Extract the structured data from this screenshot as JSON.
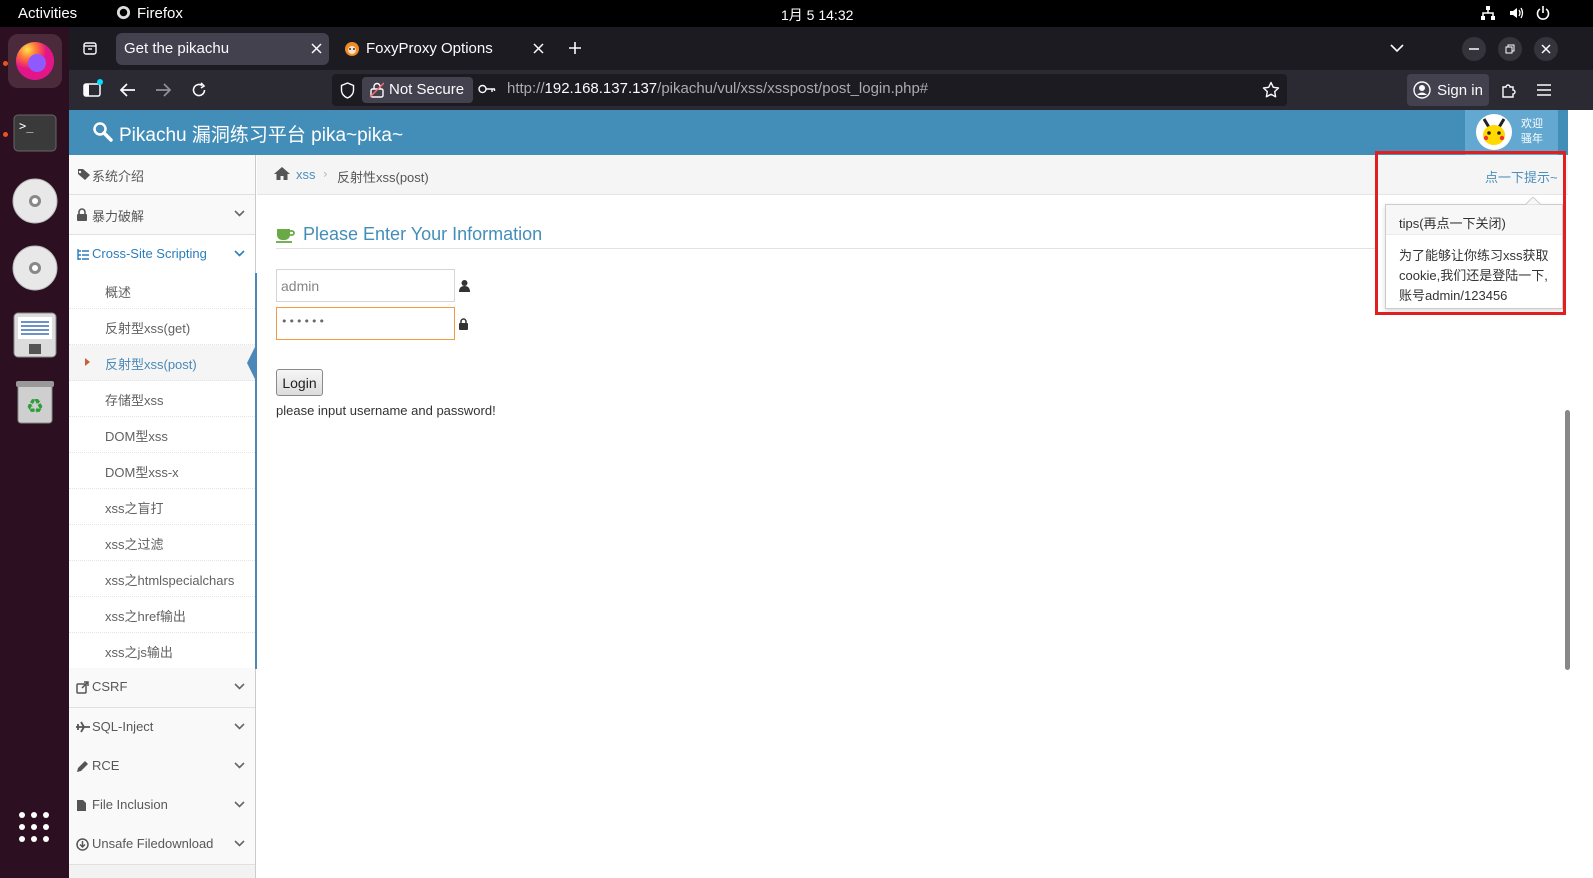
{
  "system": {
    "activities": "Activities",
    "app_name": "Firefox",
    "clock": "1月 5  14:32"
  },
  "browser": {
    "tabs": [
      {
        "title": "Get the pikachu",
        "active": true
      },
      {
        "title": "FoxyProxy Options",
        "active": false
      }
    ],
    "not_secure_label": "Not Secure",
    "url_prefix": "http://",
    "url_host": "192.168.137.137",
    "url_path": "/pikachu/vul/xss/xsspost/post_login.php#",
    "sign_in_label": "Sign in"
  },
  "site": {
    "title": "Pikachu 漏洞练习平台 pika~pika~",
    "welcome_line1": "欢迎",
    "welcome_line2": "骚年",
    "header_color": "#438eb9"
  },
  "sidebar": {
    "sections": [
      {
        "label": "系统介绍",
        "icon": "tag-icon"
      },
      {
        "label": "暴力破解",
        "icon": "lock-icon"
      },
      {
        "label": "Cross-Site Scripting",
        "icon": "tree-icon",
        "expanded": true
      }
    ],
    "xss_items": [
      "概述",
      "反射型xss(get)",
      "反射型xss(post)",
      "存储型xss",
      "DOM型xss",
      "DOM型xss-x",
      "xss之盲打",
      "xss之过滤",
      "xss之htmlspecialchars",
      "xss之href输出",
      "xss之js输出"
    ],
    "active_item_index": 2,
    "bottom_sections": [
      {
        "label": "CSRF",
        "icon": "share-icon"
      },
      {
        "label": "SQL-Inject",
        "icon": "plane-icon"
      },
      {
        "label": "RCE",
        "icon": "pencil-icon"
      },
      {
        "label": "File Inclusion",
        "icon": "file-icon"
      },
      {
        "label": "Unsafe Filedownload",
        "icon": "download-icon"
      }
    ]
  },
  "breadcrumb": {
    "parent": "xss",
    "current": "反射性xss(post)",
    "hint_link": "点一下提示~"
  },
  "form": {
    "heading": "Please Enter Your Information",
    "username_value": "admin",
    "password_value": "••••••",
    "login_label": "Login",
    "message": "please input username and password!"
  },
  "tips": {
    "title": "tips(再点一下关闭)",
    "body": "为了能够让你练习xss获取cookie,我们还是登陆一下,账号admin/123456"
  }
}
